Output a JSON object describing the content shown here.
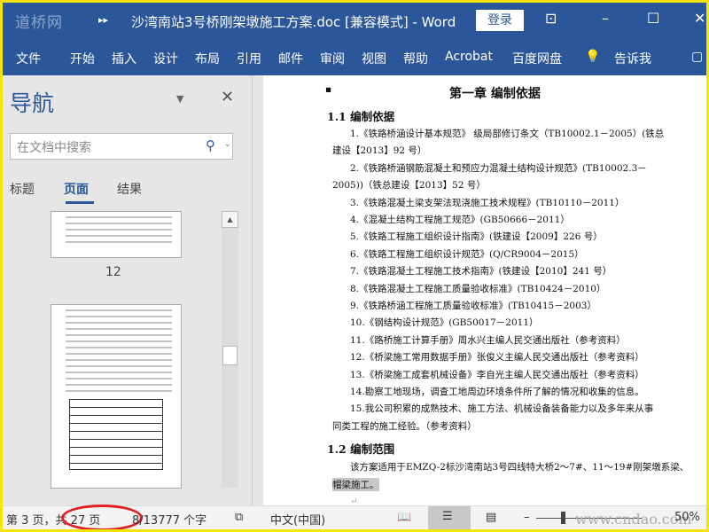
{
  "titlebar": {
    "logo": "道桥网",
    "title": "沙湾南站3号桥刚架墩施工方案.doc [兼容模式]  -  Word",
    "login": "登录"
  },
  "ribbon": {
    "tabs": [
      "文件",
      "开始",
      "插入",
      "设计",
      "布局",
      "引用",
      "邮件",
      "审阅",
      "视图",
      "帮助",
      "Acrobat",
      "百度网盘",
      "告诉我"
    ]
  },
  "nav": {
    "title": "导航",
    "search_placeholder": "在文档中搜索",
    "tabs": [
      "标题",
      "页面",
      "结果"
    ],
    "active_tab": "页面",
    "page_label": "12"
  },
  "document": {
    "chapter": "第一章  编制依据",
    "section1": "1.1 编制依据",
    "lines": [
      {
        "t": "1.《铁路桥涵设计基本规范》 级局部修订条文（TB10002.1－2005）(铁总",
        "k": "i"
      },
      {
        "t": "建设【2013】92 号）",
        "k": "c"
      },
      {
        "t": "2.《铁路桥涵钢筋混凝土和预应力混凝土结构设计规范》(TB10002.3－",
        "k": "i"
      },
      {
        "t": "2005))（铁总建设【2013】52 号）",
        "k": "c"
      },
      {
        "t": "3.《铁路混凝土梁支架法现浇施工技术规程》(TB10110－2011）",
        "k": "i"
      },
      {
        "t": "4.《混凝土结构工程施工规范》(GB50666－2011）",
        "k": "i"
      },
      {
        "t": "5.《铁路工程施工组织设计指南》(铁建设【2009】226 号）",
        "k": "i"
      },
      {
        "t": "6.《铁路工程施工组织设计规范》(Q/CR9004－2015）",
        "k": "i"
      },
      {
        "t": "7.《铁路混凝土工程施工技术指南》(铁建设【2010】241 号）",
        "k": "i"
      },
      {
        "t": "8.《铁路混凝土工程施工质量验收标准》(TB10424－2010）",
        "k": "i"
      },
      {
        "t": "9.《铁路桥涵工程施工质量验收标准》(TB10415－2003）",
        "k": "i"
      },
      {
        "t": "10.《钢结构设计规范》(GB50017－2011）",
        "k": "i"
      },
      {
        "t": "11.《路桥施工计算手册》周水兴主编人民交通出版社（参考资料）",
        "k": "i"
      },
      {
        "t": "12.《桥梁施工常用数据手册》张俊义主编人民交通出版社（参考资料）",
        "k": "i"
      },
      {
        "t": "13.《桥梁施工成套机械设备》李自光主编人民交通出版社（参考资料）",
        "k": "i"
      },
      {
        "t": "14.勘察工地现场，调查工地周边环境条件所了解的情况和收集的信息。",
        "k": "i"
      },
      {
        "t": "15.我公司积累的成熟技术、施工方法、机械设备装备能力以及多年来从事",
        "k": "i"
      },
      {
        "t": "同类工程的施工经验。（参考资料）",
        "k": "c"
      }
    ],
    "section2": "1.2 编制范围",
    "scope_line1": "该方案适用于EMZQ-2标沙湾南站3号四线特大桥2～7#、11～19#刚架墩系梁、",
    "scope_line2": "帽梁施工。"
  },
  "status": {
    "page": "第 3 页，共 27 页",
    "words": "8/13777 个字",
    "language": "中文(中国)",
    "zoom": "50%",
    "watermark": "www.cndao.com"
  }
}
